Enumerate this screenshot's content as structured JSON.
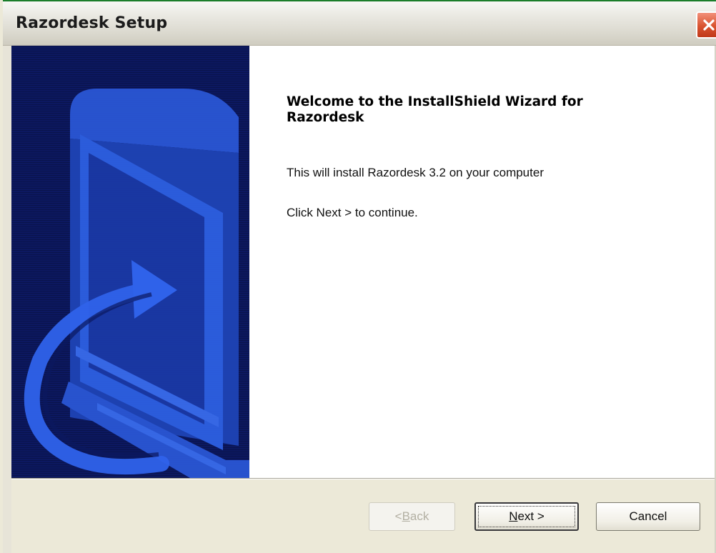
{
  "window": {
    "title": "Razordesk Setup",
    "close_icon": "close-icon"
  },
  "banner": {
    "icon": "installshield-computer-arrow-graphic",
    "background_color": "#0c1860",
    "accent_color": "#2f5fe0"
  },
  "content": {
    "welcome_title": "Welcome to the InstallShield Wizard for Razordesk",
    "install_text": "This will install Razordesk 3.2 on your computer",
    "continue_text": "Click Next > to continue."
  },
  "buttons": {
    "back_prefix": "< ",
    "back_accel": "B",
    "back_rest": "ack",
    "back_enabled": false,
    "next_accel": "N",
    "next_rest": "ext >",
    "cancel_label": "Cancel"
  }
}
